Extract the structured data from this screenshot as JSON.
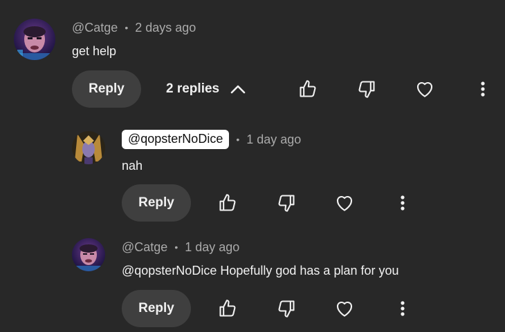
{
  "comment": {
    "author": "@Catge",
    "separator": "•",
    "time": "2 days ago",
    "text": "get help",
    "reply_label": "Reply",
    "replies_label": "2 replies",
    "icons": [
      "like-icon",
      "dislike-icon",
      "heart-icon",
      "more-icon",
      "chevron-up-icon"
    ]
  },
  "replies": [
    {
      "author": "@qopsterNoDice",
      "separator": "•",
      "time": "1 day ago",
      "text": "nah",
      "reply_label": "Reply"
    },
    {
      "author": "@Catge",
      "separator": "•",
      "time": "1 day ago",
      "text": "@qopsterNoDice Hopefully god has a plan for you",
      "reply_label": "Reply"
    }
  ],
  "colors": {
    "background": "#282828",
    "button_bg": "#3f3f3f",
    "meta_text": "#aaaaaa",
    "text": "#f1f1f1",
    "chip_bg": "#ffffff"
  }
}
